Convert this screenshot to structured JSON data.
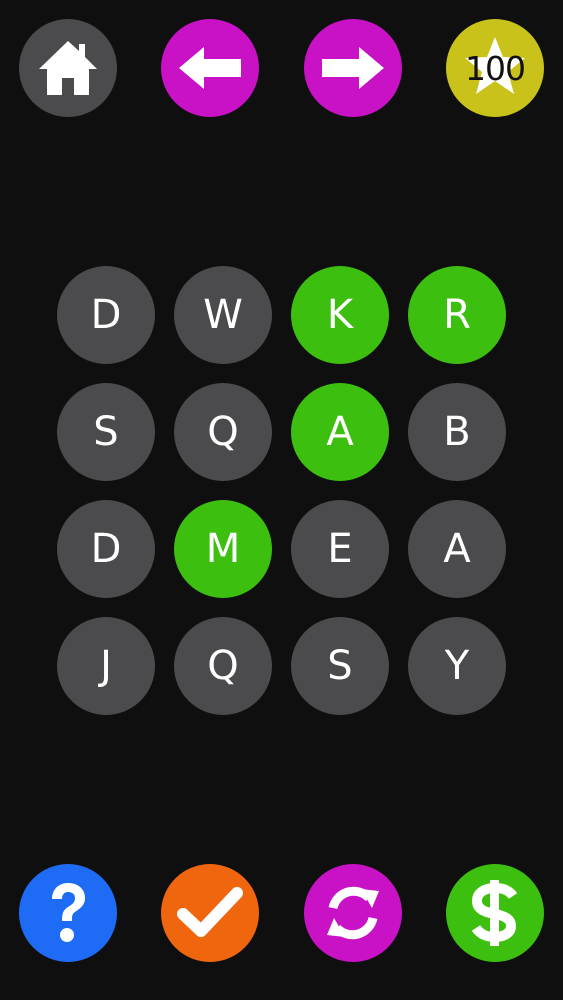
{
  "colors": {
    "background": "#0f0f10",
    "tile_default": "#4b4a4c",
    "tile_selected": "#3cbf0f",
    "home_button": "#4b4a4c",
    "nav_button": "#c912c5",
    "coin_badge": "#c8c21a",
    "help_button": "#1e6cf5",
    "check_button": "#f0660f",
    "shuffle_button": "#c912c5",
    "buy_button": "#3cbf0f"
  },
  "top_bar": {
    "home": {
      "icon": "home-icon"
    },
    "back": {
      "icon": "arrow-left-icon"
    },
    "forward": {
      "icon": "arrow-right-icon"
    },
    "coins": {
      "icon": "star-icon",
      "value": "100"
    }
  },
  "grid": {
    "tiles": [
      {
        "letter": "D",
        "selected": false
      },
      {
        "letter": "W",
        "selected": false
      },
      {
        "letter": "K",
        "selected": true
      },
      {
        "letter": "R",
        "selected": true
      },
      {
        "letter": "S",
        "selected": false
      },
      {
        "letter": "Q",
        "selected": false
      },
      {
        "letter": "A",
        "selected": true
      },
      {
        "letter": "B",
        "selected": false
      },
      {
        "letter": "D",
        "selected": false
      },
      {
        "letter": "M",
        "selected": true
      },
      {
        "letter": "E",
        "selected": false
      },
      {
        "letter": "A",
        "selected": false
      },
      {
        "letter": "J",
        "selected": false
      },
      {
        "letter": "Q",
        "selected": false
      },
      {
        "letter": "S",
        "selected": false
      },
      {
        "letter": "Y",
        "selected": false
      }
    ]
  },
  "bottom_bar": {
    "help": {
      "icon": "question-mark-icon"
    },
    "submit": {
      "icon": "checkmark-icon"
    },
    "shuffle": {
      "icon": "refresh-icon"
    },
    "shop": {
      "icon": "dollar-icon"
    }
  }
}
